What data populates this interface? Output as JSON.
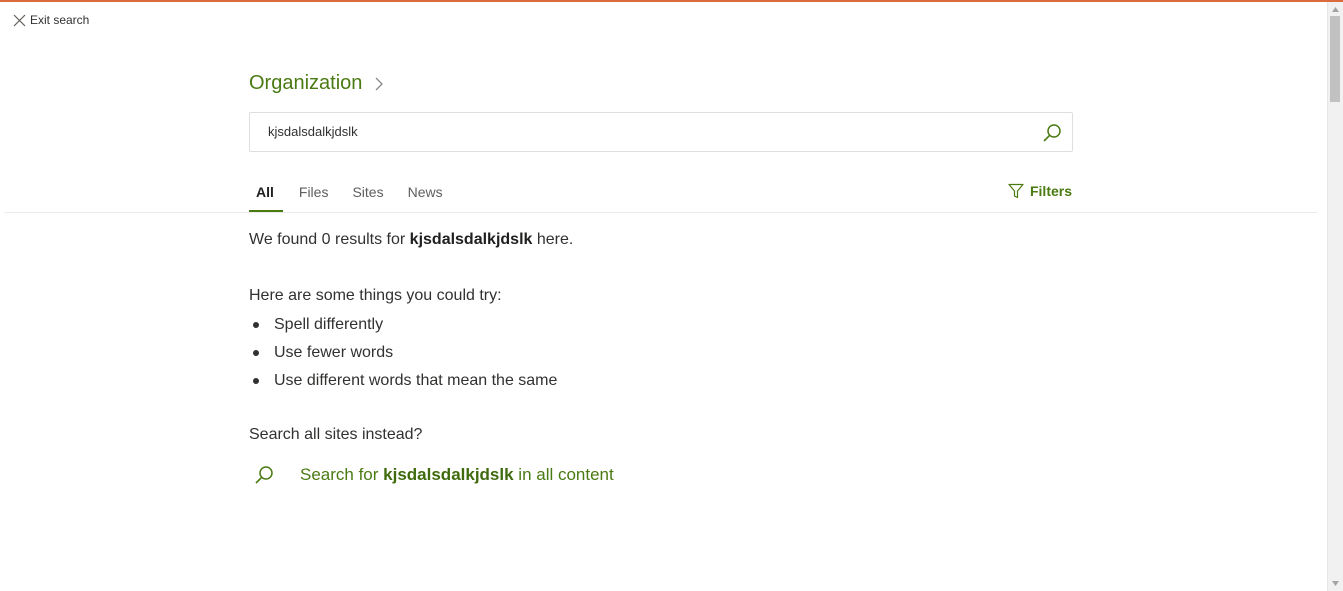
{
  "exit_search": {
    "label": "Exit search",
    "icon": "close-icon"
  },
  "breadcrumb": {
    "title": "Organization",
    "icon": "chevron-right-icon"
  },
  "search": {
    "value": "kjsdalsdalkjdslk",
    "icon": "search-icon"
  },
  "tabs": [
    {
      "label": "All",
      "active": true
    },
    {
      "label": "Files",
      "active": false
    },
    {
      "label": "Sites",
      "active": false
    },
    {
      "label": "News",
      "active": false
    }
  ],
  "filters": {
    "label": "Filters",
    "icon": "filter-icon"
  },
  "results": {
    "prefix": "We found 0 results for ",
    "query": "kjsdalsdalkjdslk",
    "suffix": " here."
  },
  "tips": {
    "heading": "Here are some things you could try:",
    "items": [
      "Spell differently",
      "Use fewer words",
      "Use different words that mean the same"
    ]
  },
  "alternate": {
    "heading": "Search all sites instead?",
    "link_prefix": "Search for ",
    "link_query": "kjsdalsdalkjdslk",
    "link_suffix": " in all content",
    "icon": "search-icon"
  },
  "colors": {
    "accent": "#4a7a12",
    "top_bar": "#d86b3e",
    "text": "#323130"
  }
}
